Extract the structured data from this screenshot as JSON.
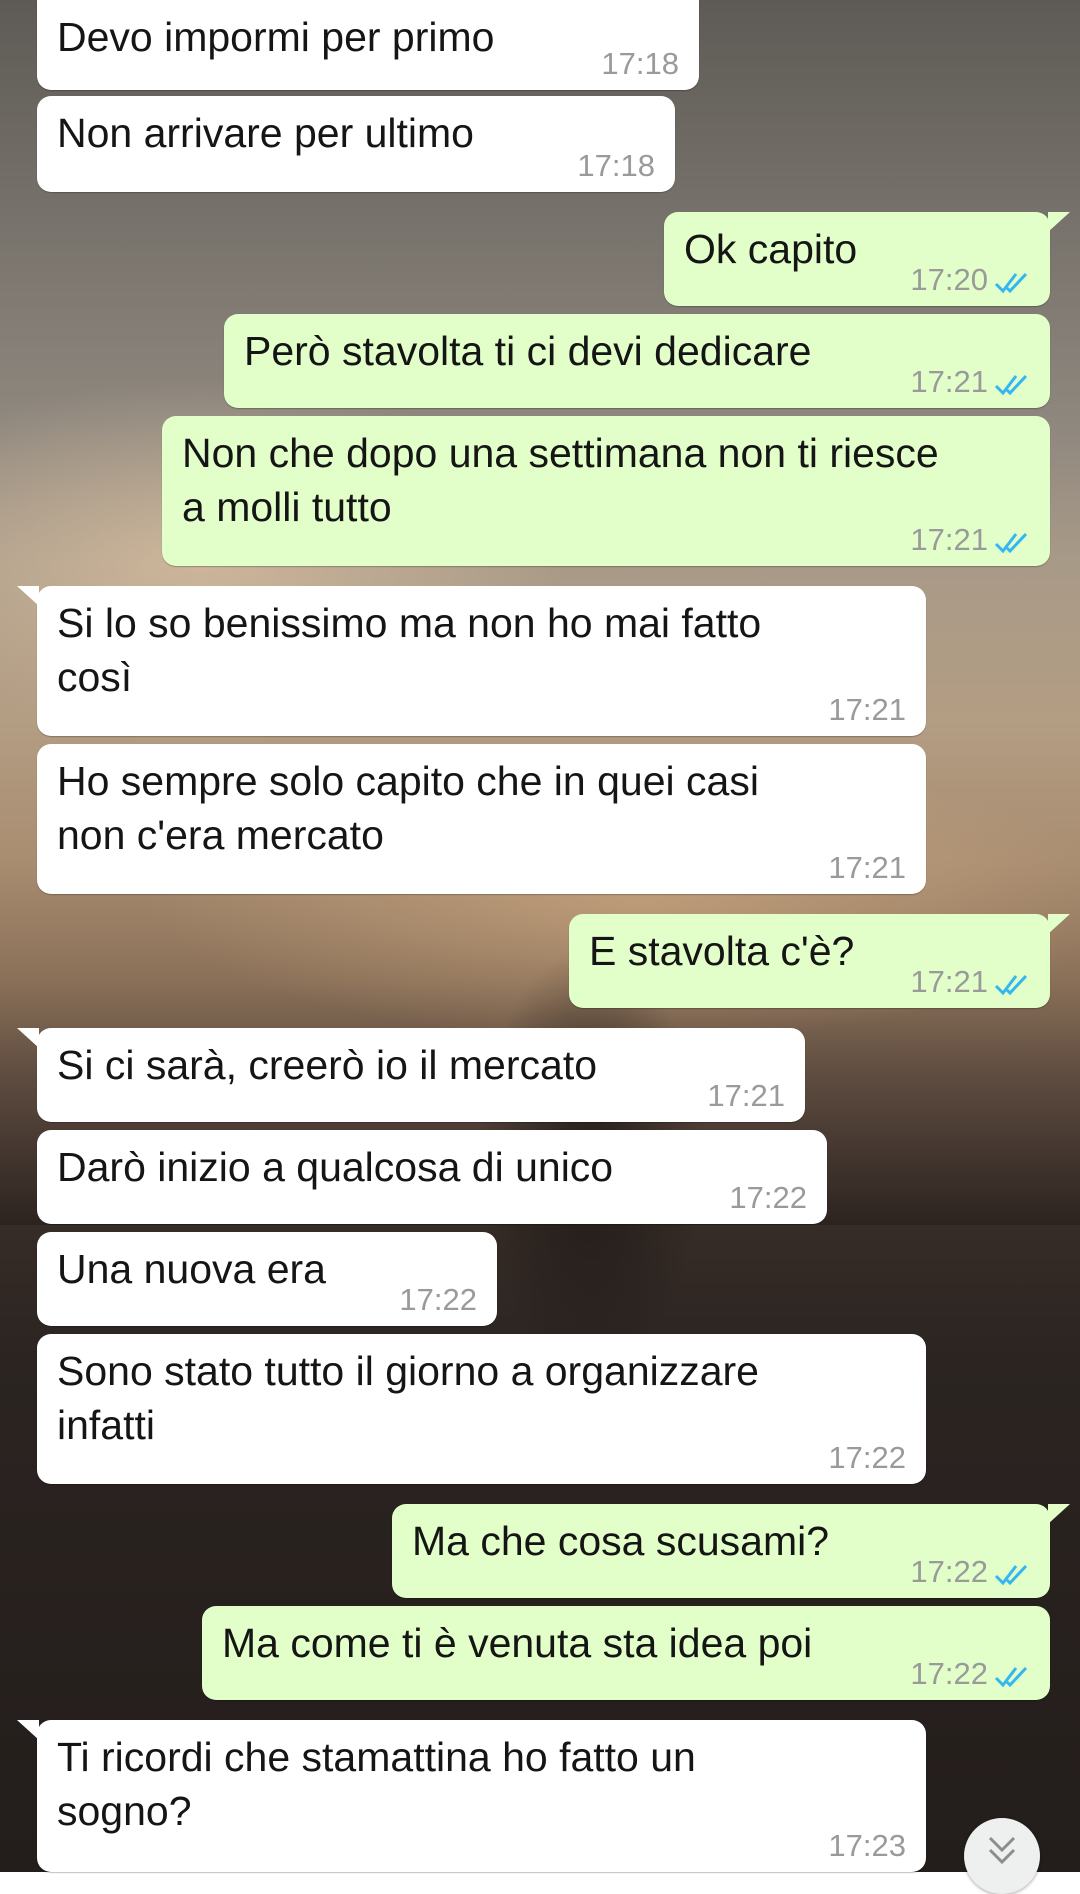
{
  "wallpaper": "sunset-silhouette-wallpaper",
  "colors": {
    "incoming_bubble": "#ffffff",
    "outgoing_bubble": "#e2fec9",
    "read_ticks": "#34b7f1",
    "timestamp": "#9a9a9a"
  },
  "messages": [
    {
      "dir": "in",
      "text": "Devo impormi per primo",
      "time": "17:18"
    },
    {
      "dir": "in",
      "text": "Non arrivare per ultimo",
      "time": "17:18"
    },
    {
      "dir": "out",
      "text": "Ok capito",
      "time": "17:20",
      "status": "read"
    },
    {
      "dir": "out",
      "text": "Però stavolta ti ci devi dedicare",
      "time": "17:21",
      "status": "read"
    },
    {
      "dir": "out",
      "text": "Non che dopo una settimana non ti riesce a molli tutto",
      "lines": [
        "Non che dopo una settimana non ti riesce",
        "a molli tutto"
      ],
      "time": "17:21",
      "status": "read"
    },
    {
      "dir": "in",
      "text": "Si lo so benissimo ma non ho mai fatto così",
      "lines": [
        "Si lo so benissimo ma non ho mai fatto",
        "così"
      ],
      "time": "17:21"
    },
    {
      "dir": "in",
      "text": "Ho sempre solo capito che in quei casi non c'era mercato",
      "lines": [
        "Ho sempre solo capito che in quei casi",
        "non c'era mercato"
      ],
      "time": "17:21"
    },
    {
      "dir": "out",
      "text": "E stavolta c'è?",
      "time": "17:21",
      "status": "read"
    },
    {
      "dir": "in",
      "text": "Si ci sarà, creerò io il mercato",
      "time": "17:21"
    },
    {
      "dir": "in",
      "text": "Darò inizio a qualcosa di unico",
      "time": "17:22"
    },
    {
      "dir": "in",
      "text": "Una nuova era",
      "time": "17:22"
    },
    {
      "dir": "in",
      "text": "Sono stato tutto il giorno a organizzare infatti",
      "lines": [
        "Sono stato tutto il giorno a organizzare",
        "infatti"
      ],
      "time": "17:22"
    },
    {
      "dir": "out",
      "text": "Ma che cosa scusami?",
      "time": "17:22",
      "status": "read"
    },
    {
      "dir": "out",
      "text": "Ma come ti è venuta sta idea poi",
      "time": "17:22",
      "status": "read"
    },
    {
      "dir": "in",
      "text": "Ti ricordi che stamattina ho fatto un sogno?",
      "lines": [
        "Ti ricordi che stamattina ho fatto un",
        "sogno?"
      ],
      "time": "17:23"
    }
  ],
  "scroll_to_bottom": {
    "icon": "double-chevron-down-icon"
  }
}
